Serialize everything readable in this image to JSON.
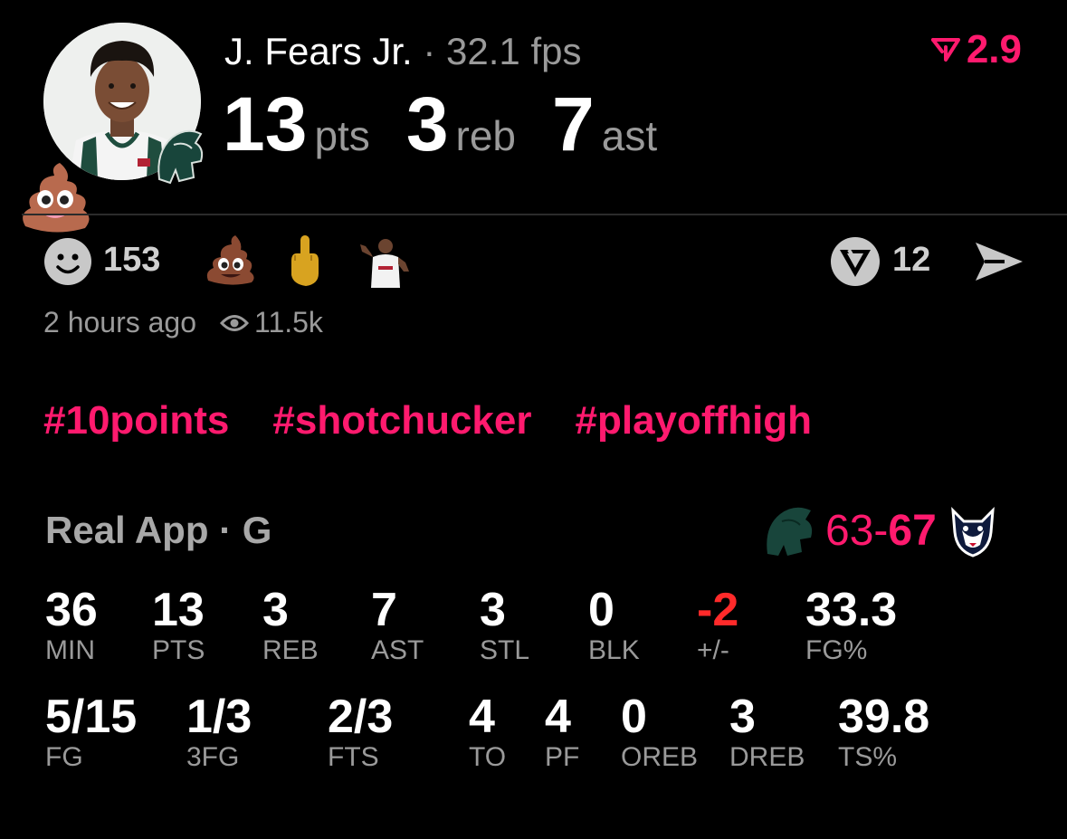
{
  "header": {
    "player_name": "J. Fears Jr.",
    "separator": "·",
    "fps": "32.1 fps",
    "trend_value": "2.9",
    "stats": [
      {
        "value": "13",
        "unit": "pts"
      },
      {
        "value": "3",
        "unit": "reb"
      },
      {
        "value": "7",
        "unit": "ast"
      }
    ]
  },
  "reactions": {
    "count": "153",
    "items": [
      "poop-emoji-icon",
      "middle-finger-emoji-icon",
      "player-flex-icon"
    ],
    "vs_count": "12"
  },
  "meta": {
    "time_ago": "2 hours ago",
    "views": "11.5k"
  },
  "tags": [
    "#10points",
    "#shotchucker",
    "#playoffhigh"
  ],
  "game": {
    "title": "Real App · G",
    "score_home": "63",
    "score_dash": "-",
    "score_away": "67"
  },
  "stats_row1": [
    {
      "value": "36",
      "label": "MIN"
    },
    {
      "value": "13",
      "label": "PTS"
    },
    {
      "value": "3",
      "label": "REB"
    },
    {
      "value": "7",
      "label": "AST"
    },
    {
      "value": "3",
      "label": "STL"
    },
    {
      "value": "0",
      "label": "BLK"
    },
    {
      "value": "-2",
      "label": "+/-"
    },
    {
      "value": "33.3",
      "label": "FG%"
    }
  ],
  "stats_row2": [
    {
      "value": "5/15",
      "label": "FG"
    },
    {
      "value": "1/3",
      "label": "3FG"
    },
    {
      "value": "2/3",
      "label": "FTS"
    },
    {
      "value": "4",
      "label": "TO"
    },
    {
      "value": "4",
      "label": "PF"
    },
    {
      "value": "0",
      "label": "OREB"
    },
    {
      "value": "3",
      "label": "DREB"
    },
    {
      "value": "39.8",
      "label": "TS%"
    }
  ],
  "colors": {
    "accent": "#ff1a6e",
    "negative": "#ff2a2a",
    "muted": "#9a9a9a",
    "spartan_green": "#18453b"
  }
}
